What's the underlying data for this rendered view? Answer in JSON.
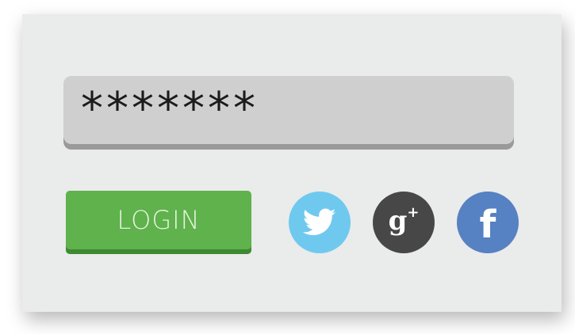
{
  "form": {
    "password_value": "*******",
    "login_label": "LOGIN"
  },
  "social": {
    "twitter": {
      "icon": "twitter-icon",
      "color": "#6fc9ef"
    },
    "google_plus": {
      "icon": "google-plus-icon",
      "color": "#474747",
      "glyph": "g",
      "glyph_plus": "+"
    },
    "facebook": {
      "icon": "facebook-icon",
      "color": "#5681c2",
      "glyph": "f"
    }
  },
  "colors": {
    "card_background": "#eaebeb",
    "field_background": "#cfcfcf",
    "login_green": "#5fb24c"
  }
}
